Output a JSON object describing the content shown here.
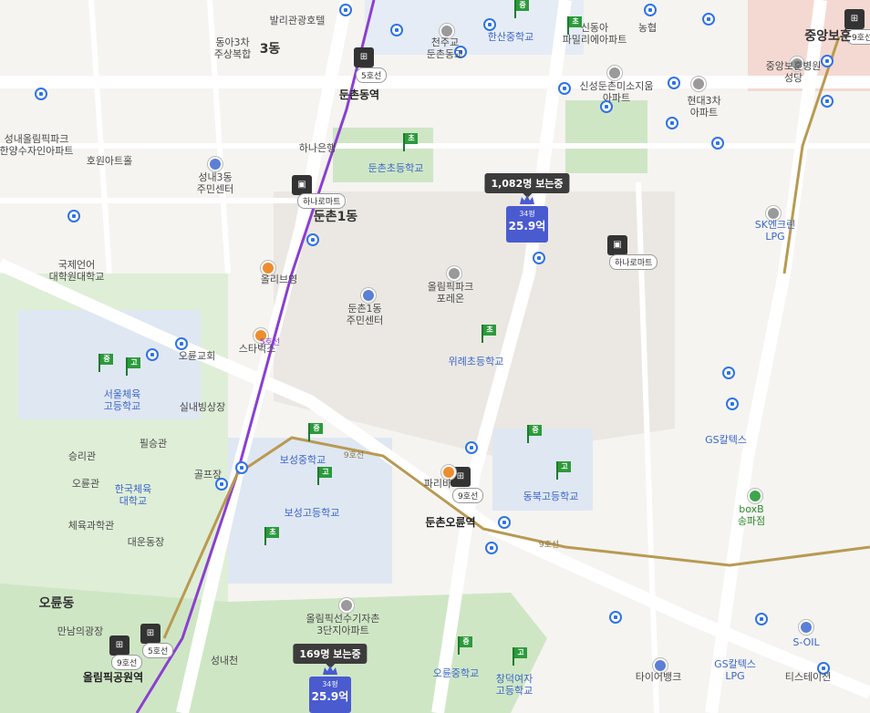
{
  "map": {
    "title": "",
    "colors": {
      "bus": "#2f73e6",
      "line5": "#8a3fd1",
      "line9": "#b89a52",
      "school": "#2c9a3c",
      "listing": "#4a5bd0"
    }
  },
  "labels": {
    "garden": "동아3차\n주상복합",
    "dong3": "3동",
    "bali": "발리관광호텔",
    "chunju": "천주교\n둔촌동교",
    "hansan": "한산중학교",
    "sinsungA": "신동아\n파밀리에아파트",
    "nonghyup": "농협",
    "sinseong": "신성둔촌미소지움\n아파트",
    "hyundai3": "현대3차\n아파트",
    "jungang": "중앙보훈",
    "jungangHosp": "중앙보훈병원\n성당",
    "dunchon_station_top": "둔촌동역",
    "hana": "하나은행",
    "dunchon_elem": "둔촌초등학교",
    "seongnae3": "성내3동\n주민센터",
    "hana_mart": "하나로마트",
    "dunchon1": "둔촌1동",
    "olpark": "성내올림픽파크\n한양수자인아파트",
    "hoewon": "호원아트홀",
    "sk": "SK엔크린\nLPG",
    "kuje": "국제언어\n대학원대학교",
    "oliveyoung": "올리브영",
    "olympic_apt": "올림픽파크\n포레온",
    "dunchon1_center": "둔촌1동\n주민센터",
    "starbucks": "스타벅스",
    "oryun_church": "오륜교회",
    "wirye": "위례초등학교",
    "seoul_pe": "서울체육\n고등학교",
    "ice": "실내빙상장",
    "gs": "GS칼텍스",
    "seungri": "승리관",
    "pilseung": "필승관",
    "boseong_mid": "보성중학교",
    "oryun_hall": "오륜관",
    "golf": "골프장",
    "knsu": "한국체육\n대학교",
    "boseong_high": "보성고등학교",
    "dongbuk": "동북고등학교",
    "boxb": "boxB\n송파점",
    "dunchon_oryun": "둔촌오륜역",
    "pe_science": "체육과학관",
    "daeun": "대운동장",
    "oryun_dong": "오륜동",
    "manin": "만남의광장",
    "olympic_apt2": "올림픽선수기자촌\n3단지아파트",
    "olympic_park_station": "올림픽공원역",
    "seongnaecheon": "성내천",
    "oryun_mid": "오륜중학교",
    "changduk": "창덕여자\n고등학교",
    "tire": "타이어뱅크",
    "gs_lpg": "GS칼텍스\nLPG",
    "soil": "S-OIL",
    "tistation": "티스테이션",
    "line5_label": "5호선",
    "line9_label": "9호선",
    "line9_label2": "9호선",
    "paris": "파리바"
  },
  "listings": [
    {
      "viewers": "1,082명 보는중",
      "size": "34평",
      "price": "25.9억"
    },
    {
      "viewers": "169명 보는중",
      "size": "34평",
      "price": "25.9억"
    }
  ],
  "station_tags": {
    "line5_top": "5호선",
    "line9_top": "9호선",
    "line9_mid": "9호선",
    "line9_bottom": "9호선",
    "line5_bottom": "5호선"
  },
  "school_flags": {
    "cho": "초",
    "jung": "중",
    "go": "고"
  },
  "mart_tags": {
    "mart1": "하나로마트",
    "mart2": "하나로마트"
  }
}
